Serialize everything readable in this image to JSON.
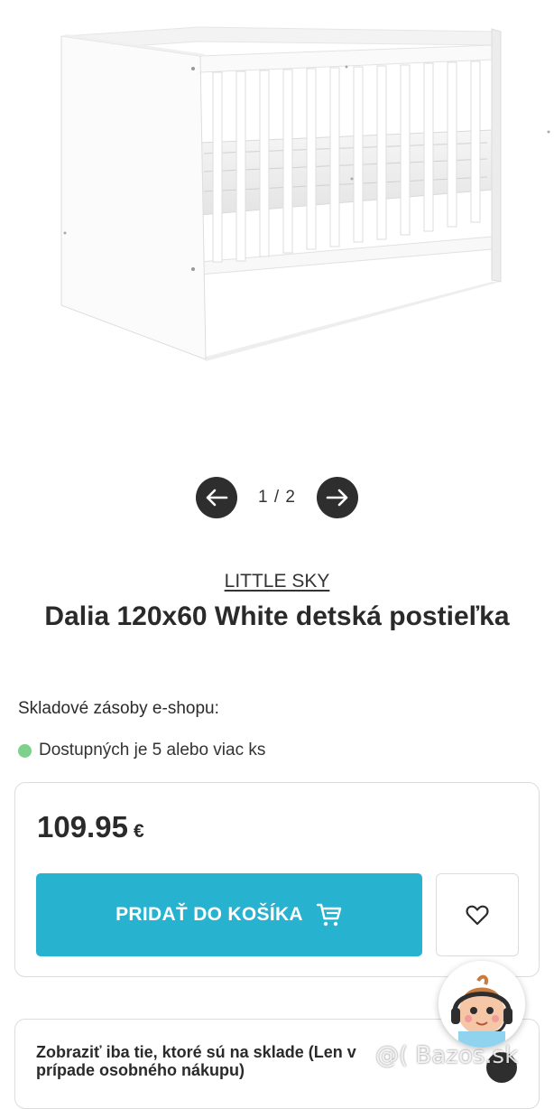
{
  "gallery": {
    "image_alt": "white baby crib",
    "counter": "1 / 2",
    "prev_icon": "arrow-left-icon",
    "next_icon": "arrow-right-icon"
  },
  "product": {
    "brand": "LITTLE SKY",
    "title": "Dalia 120x60 White detská postieľka",
    "stock_label": "Skladové zásoby e-shopu:",
    "stock_status": "Dostupných je 5 alebo viac ks",
    "stock_color": "#7fd08a"
  },
  "price": {
    "amount": "109.95",
    "currency": "€"
  },
  "cart_button": {
    "label": "PRIDAŤ DO KOŠÍKA",
    "icon": "cart-icon",
    "color": "#27b2d0"
  },
  "wishlist": {
    "icon": "heart-icon"
  },
  "filter": {
    "text": "Zobraziť iba tie, ktoré sú na sklade (Len v prípade osobného nákupu)"
  },
  "watermark": "@( Bazos.sk"
}
